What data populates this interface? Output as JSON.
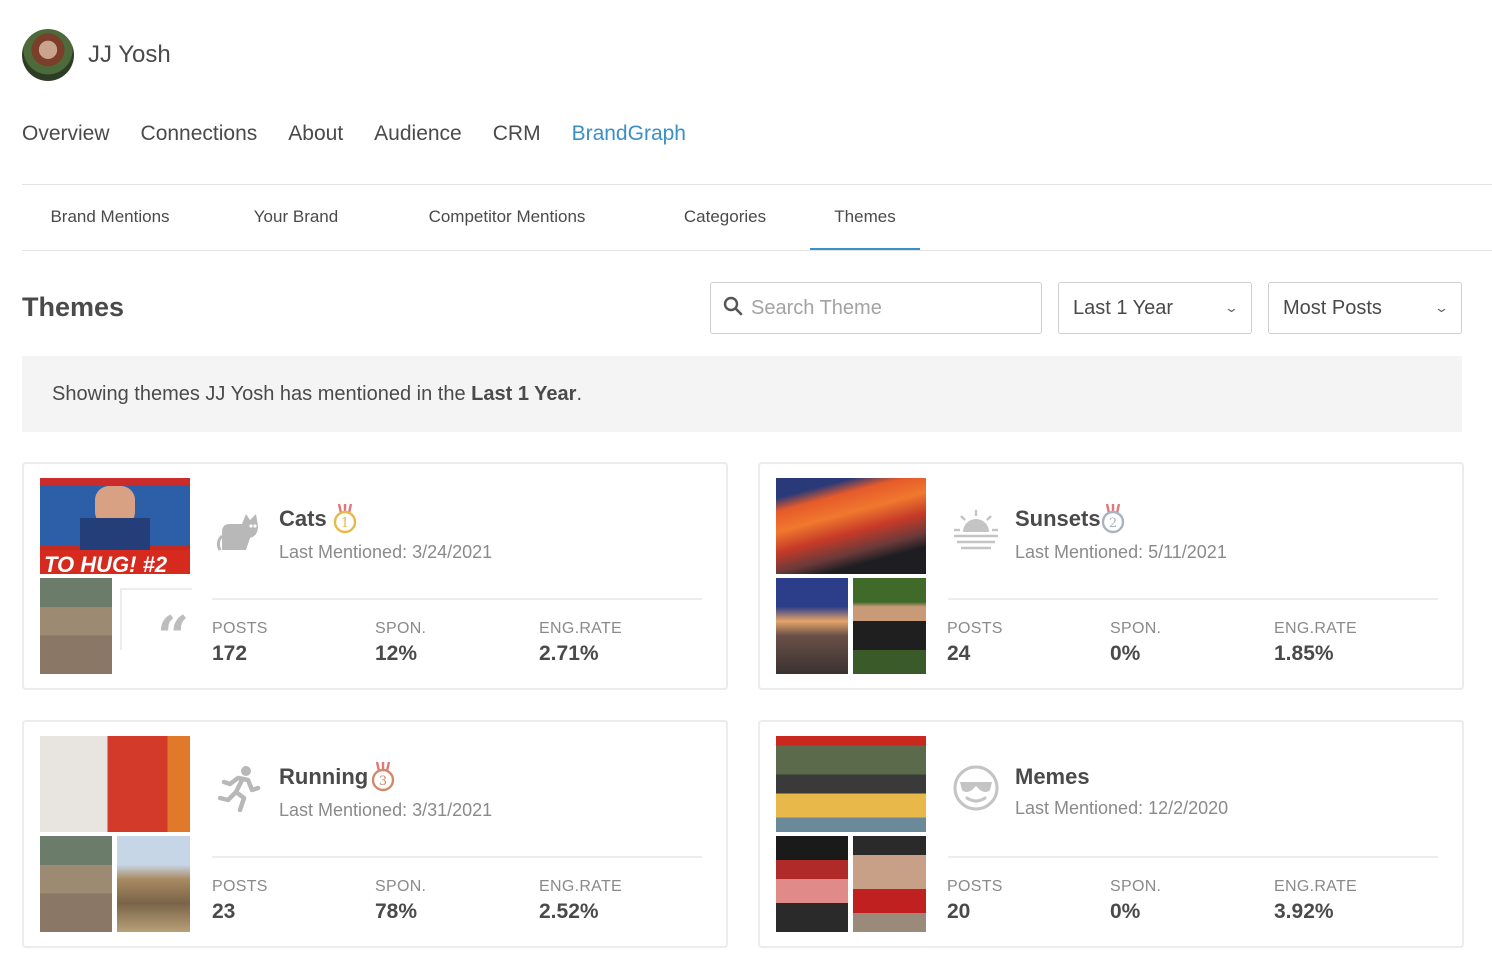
{
  "profile": {
    "name": "JJ Yosh"
  },
  "main_nav": [
    {
      "label": "Overview",
      "active": false
    },
    {
      "label": "Connections",
      "active": false
    },
    {
      "label": "About",
      "active": false
    },
    {
      "label": "Audience",
      "active": false
    },
    {
      "label": "CRM",
      "active": false
    },
    {
      "label": "BrandGraph",
      "active": true
    }
  ],
  "sub_nav": [
    {
      "label": "Brand Mentions",
      "active": false
    },
    {
      "label": "Your Brand",
      "active": false
    },
    {
      "label": "Competitor Mentions",
      "active": false
    },
    {
      "label": "Categories",
      "active": false
    },
    {
      "label": "Themes",
      "active": true
    }
  ],
  "page_title": "Themes",
  "search": {
    "placeholder": "Search Theme",
    "value": ""
  },
  "filters": {
    "period": "Last 1 Year",
    "sort": "Most Posts"
  },
  "banner": {
    "prefix": "Showing themes JJ Yosh has mentioned in the ",
    "highlight": "Last 1 Year",
    "suffix": "."
  },
  "stat_labels": {
    "posts": "POSTS",
    "spon": "SPON.",
    "eng": "ENG.RATE"
  },
  "colors": {
    "accent": "#3a8fc7",
    "gold": "#e8b84a",
    "silver": "#a9b4bf",
    "bronze": "#d08a6a"
  },
  "themes": [
    {
      "name": "Cats",
      "icon": "cat-icon",
      "rank": "1",
      "last_mentioned": "Last Mentioned: 3/24/2021",
      "posts": "172",
      "spon": "12%",
      "eng": "2.71%"
    },
    {
      "name": "Sunsets",
      "icon": "sunset-icon",
      "rank": "2",
      "last_mentioned": "Last Mentioned: 5/11/2021",
      "posts": "24",
      "spon": "0%",
      "eng": "1.85%"
    },
    {
      "name": "Running",
      "icon": "running-icon",
      "rank": "3",
      "last_mentioned": "Last Mentioned: 3/31/2021",
      "posts": "23",
      "spon": "78%",
      "eng": "2.52%"
    },
    {
      "name": "Memes",
      "icon": "sunglasses-face-icon",
      "rank": "",
      "last_mentioned": "Last Mentioned: 12/2/2020",
      "posts": "20",
      "spon": "0%",
      "eng": "3.92%"
    }
  ]
}
